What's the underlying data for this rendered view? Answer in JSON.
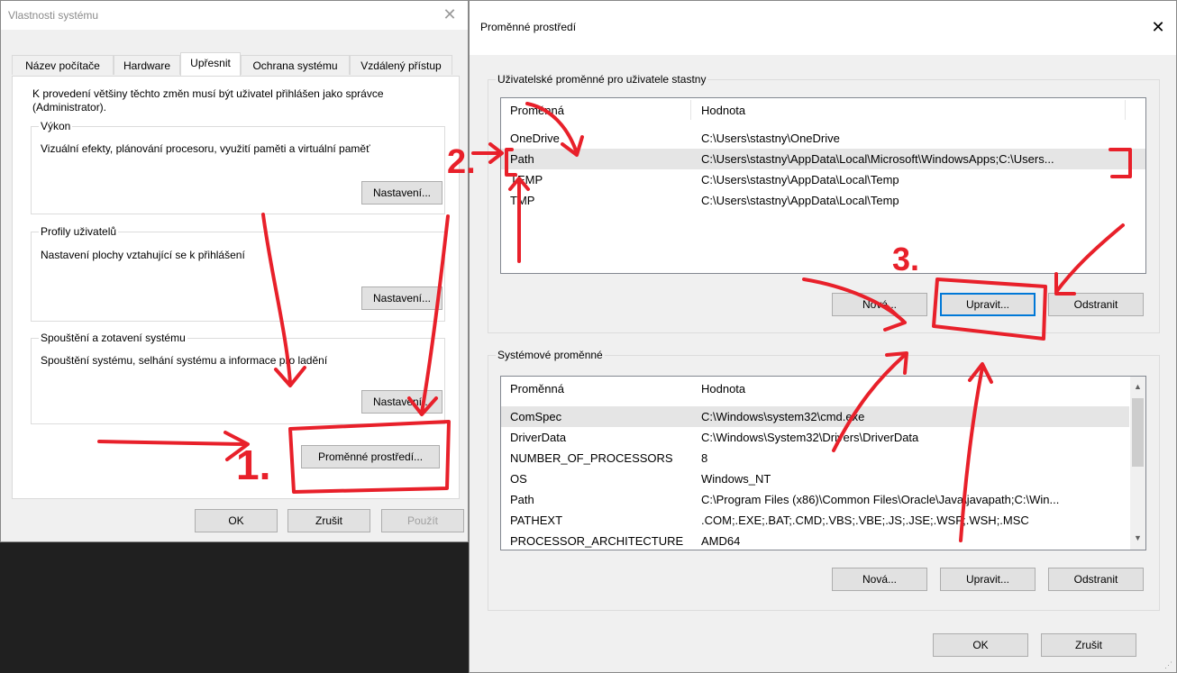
{
  "left_dialog": {
    "title": "Vlastnosti systému",
    "close_glyph": "✕",
    "tabs": [
      "Název počítače",
      "Hardware",
      "Upřesnit",
      "Ochrana systému",
      "Vzdálený přístup"
    ],
    "admin_notice": "K provedení většiny těchto změn musí být uživatel přihlášen jako správce (Administrator).",
    "performance": {
      "label": "Výkon",
      "description": "Vizuální efekty, plánování procesoru, využití paměti a virtuální paměť",
      "button": "Nastavení..."
    },
    "profiles": {
      "label": "Profily uživatelů",
      "description": "Nastavení plochy vztahující se k přihlášení",
      "button": "Nastavení..."
    },
    "startup": {
      "label": "Spouštění a zotavení systému",
      "description": "Spouštění systému, selhání systému a informace pro ladění",
      "button": "Nastavení..."
    },
    "env_button": "Proměnné prostředí...",
    "ok": "OK",
    "cancel": "Zrušit",
    "apply": "Použít"
  },
  "right_dialog": {
    "title": "Proměnné prostředí",
    "close_glyph": "✕",
    "user_group_label": "Uživatelské proměnné pro uživatele stastny",
    "system_group_label": "Systémové proměnné",
    "col_variable": "Proměnná",
    "col_value": "Hodnota",
    "user_vars": [
      {
        "name": "OneDrive",
        "value": "C:\\Users\\stastny\\OneDrive"
      },
      {
        "name": "Path",
        "value": "C:\\Users\\stastny\\AppData\\Local\\Microsoft\\WindowsApps;C:\\Users..."
      },
      {
        "name": "TEMP",
        "value": "C:\\Users\\stastny\\AppData\\Local\\Temp"
      },
      {
        "name": "TMP",
        "value": "C:\\Users\\stastny\\AppData\\Local\\Temp"
      }
    ],
    "system_vars": [
      {
        "name": "ComSpec",
        "value": "C:\\Windows\\system32\\cmd.exe"
      },
      {
        "name": "DriverData",
        "value": "C:\\Windows\\System32\\Drivers\\DriverData"
      },
      {
        "name": "NUMBER_OF_PROCESSORS",
        "value": "8"
      },
      {
        "name": "OS",
        "value": "Windows_NT"
      },
      {
        "name": "Path",
        "value": "C:\\Program Files (x86)\\Common Files\\Oracle\\Java\\javapath;C:\\Win..."
      },
      {
        "name": "PATHEXT",
        "value": ".COM;.EXE;.BAT;.CMD;.VBS;.VBE;.JS;.JSE;.WSF;.WSH;.MSC"
      },
      {
        "name": "PROCESSOR_ARCHITECTURE",
        "value": "AMD64"
      }
    ],
    "user_buttons": {
      "new": "Nová...",
      "edit": "Upravit...",
      "delete": "Odstranit"
    },
    "system_buttons": {
      "new": "Nová...",
      "edit": "Upravit...",
      "delete": "Odstranit"
    },
    "ok": "OK",
    "cancel": "Zrušit"
  },
  "annotations": {
    "step1": "1.",
    "step2": "2.",
    "step3": "3."
  },
  "colors": {
    "annotation": "#e8202a",
    "focus": "#0078d7",
    "selection": "#e5e5e5"
  }
}
